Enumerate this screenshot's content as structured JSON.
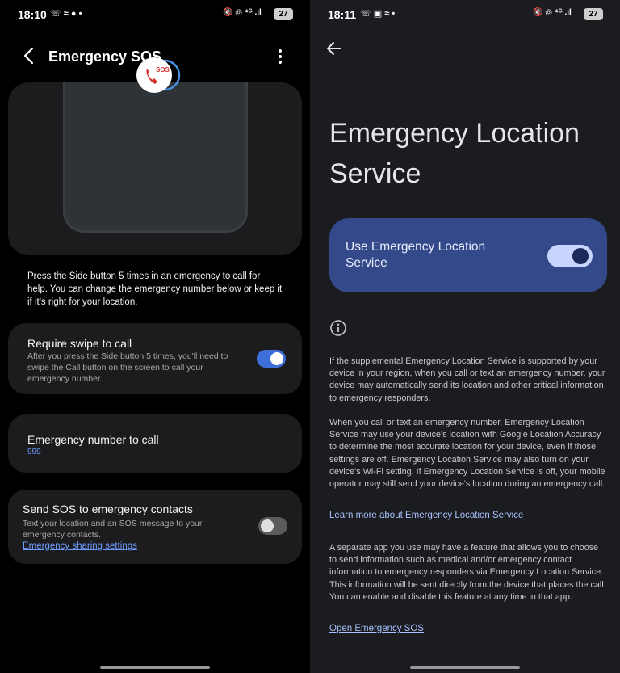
{
  "left": {
    "status": {
      "time": "18:10",
      "noti_icons": "☏ ≈ ● •",
      "sys_icons": "🔇 ◎ ⁴ᴳ .ıl",
      "battery": "27"
    },
    "header": {
      "title": "Emergency SOS"
    },
    "description": "Press the Side button 5 times in an emergency to call for help. You can change the emergency number below or keep it if it's right for your location.",
    "swipe": {
      "title": "Require swipe to call",
      "subtitle": "After you press the Side button 5 times, you'll need to swipe the Call button on the screen to call your emergency number.",
      "enabled": true
    },
    "number": {
      "title": "Emergency number to call",
      "value": "999"
    },
    "sos_contacts": {
      "title": "Send SOS to emergency contacts",
      "subtitle": "Text your location and an SOS message to your emergency contacts.",
      "link": "Emergency sharing settings",
      "enabled": false
    },
    "colors": {
      "accent": "#3e6fd8",
      "link": "#6e9cff"
    }
  },
  "right": {
    "status": {
      "time": "18:11",
      "noti_icons": "☏ ▣ ≈ •",
      "sys_icons": "🔇 ◎ ⁴ᴳ .ıl",
      "battery": "27"
    },
    "title": "Emergency Location Service",
    "toggle_label": "Use Emergency Location Service",
    "toggle_enabled": true,
    "para1": "If the supplemental Emergency Location Service is supported by your device in your region, when you call or text an emergency number, your device may automatically send its location and other critical information to emergency responders.",
    "para2": "When you call or text an emergency number, Emergency Location Service may use your device's location with Google Location Accuracy to determine the most accurate location for your device, even if those settings are off. Emergency Location Service may also turn on your device's Wi-Fi setting. If Emergency Location Service is off, your mobile operator may still send your device's location during an emergency call.",
    "learn_more": "Learn more about Emergency Location Service",
    "para3": "A separate app you use may have a feature that allows you to choose to send information such as medical and/or emergency contact information to emergency responders via Emergency Location Service. This information will be sent directly from the device that places the call. You can enable and disable this feature at any time in that app.",
    "open_sos": "Open Emergency SOS",
    "colors": {
      "card": "#34498a",
      "link": "#a8c0ff"
    }
  }
}
